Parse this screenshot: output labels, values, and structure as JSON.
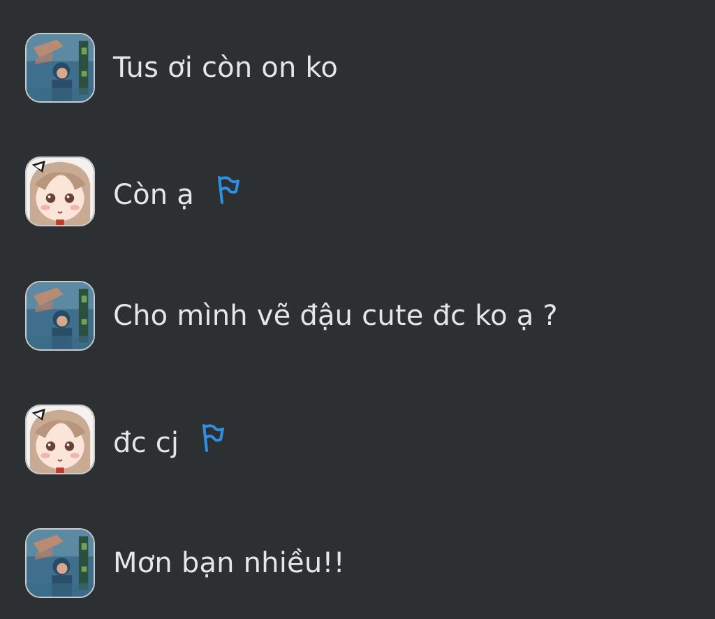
{
  "messages": [
    {
      "text": "Tus ơi còn on ko",
      "avatar": "avatar-blue",
      "flag": false
    },
    {
      "text": "Còn ạ",
      "avatar": "avatar-anime",
      "flag": true
    },
    {
      "text": "Cho mình vẽ đậu cute đc ko ạ ?",
      "avatar": "avatar-blue",
      "flag": false
    },
    {
      "text": "đc cj",
      "avatar": "avatar-anime",
      "flag": true
    },
    {
      "text": "Mơn bạn nhiều!!",
      "avatar": "avatar-blue",
      "flag": false
    }
  ],
  "colors": {
    "background": "#2c3033",
    "text": "#e4e6e7",
    "flag": "#2f8fe0"
  },
  "icons": {
    "flag": "flag-icon"
  }
}
